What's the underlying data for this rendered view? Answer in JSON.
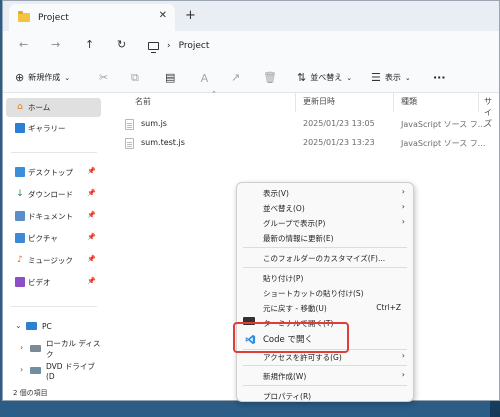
{
  "window": {
    "tab_title": "Project",
    "tab_close": "✕",
    "new_tab": "+"
  },
  "address": {
    "path": "Project"
  },
  "toolbar": {
    "new_label": "新規作成",
    "sort_label": "並べ替え",
    "view_label": "表示",
    "more_label": "···"
  },
  "sidebar": {
    "home": "ホーム",
    "gallery": "ギャラリー",
    "quick": [
      "デスクトップ",
      "ダウンロード",
      "ドキュメント",
      "ピクチャ",
      "ミュージック",
      "ビデオ"
    ],
    "pc": "PC",
    "local_disk": "ローカル ディスク",
    "dvd": "DVD ドライブ (D"
  },
  "columns": {
    "name": "名前",
    "modified": "更新日時",
    "type": "種類",
    "size": "サイズ"
  },
  "files": [
    {
      "name": "sum.js",
      "modified": "2025/01/23 13:05",
      "type": "JavaScript ソース フ..."
    },
    {
      "name": "sum.test.js",
      "modified": "2025/01/23 13:23",
      "type": "JavaScript ソース フ..."
    }
  ],
  "status": {
    "count": "2 個の項目"
  },
  "context_menu": {
    "view": "表示(V)",
    "sort": "並べ替え(O)",
    "group": "グループで表示(P)",
    "refresh": "最新の情報に更新(E)",
    "customize": "このフォルダーのカスタマイズ(F)...",
    "paste": "貼り付け(P)",
    "paste_shortcut": "ショートカットの貼り付け(S)",
    "undo": "元に戻す - 移動(U)",
    "undo_shortcut": "Ctrl+Z",
    "terminal": "ターミナルで開く(T)",
    "open_code": "Code で開く",
    "access": "アクセスを許可する(G)",
    "new": "新規作成(W)",
    "properties": "プロパティ(R)"
  },
  "colors": {
    "highlight": "#e23c36",
    "vscode": "#2c8ee0",
    "folder": "#f4c342"
  }
}
